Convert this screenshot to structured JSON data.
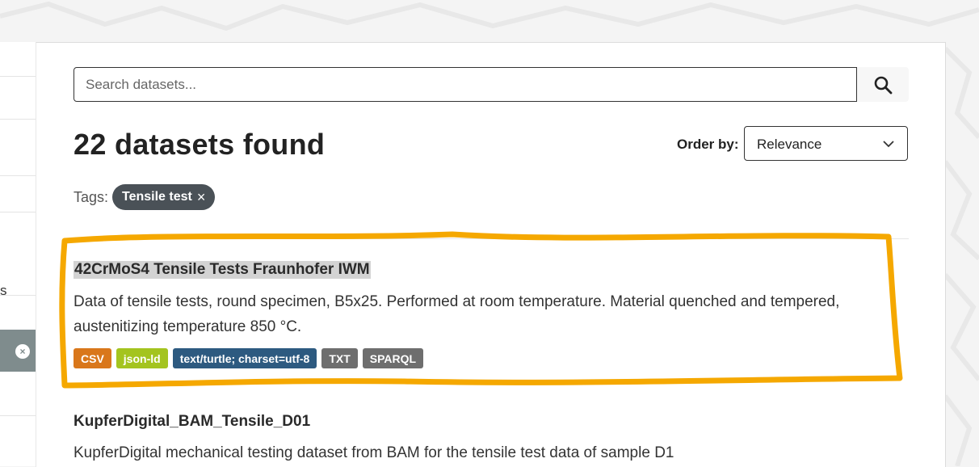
{
  "search": {
    "placeholder": "Search datasets..."
  },
  "results": {
    "heading": "22 datasets found",
    "order_by_label": "Order by:",
    "order_by_value": "Relevance"
  },
  "tags": {
    "label": "Tags:",
    "active": [
      {
        "label": "Tensile test",
        "remove": "×"
      }
    ]
  },
  "sidebar": {
    "text_fragment": "s",
    "remove_icon": "×"
  },
  "datasets": [
    {
      "title": "42CrMoS4 Tensile Tests Fraunhofer IWM",
      "description": "Data of tensile tests, round specimen, B5x25. Performed at room temperature. Material quenched and tempered, austenitizing temperature 850 °C.",
      "formats": [
        {
          "label": "CSV",
          "color": "#d9771b"
        },
        {
          "label": "json-ld",
          "color": "#a4c41f"
        },
        {
          "label": "text/turtle; charset=utf-8",
          "color": "#2d5a80"
        },
        {
          "label": "TXT",
          "color": "#6e6e6e"
        },
        {
          "label": "SPARQL",
          "color": "#6e6e6e"
        }
      ]
    },
    {
      "title": "KupferDigital_BAM_Tensile_D01",
      "description": "KupferDigital mechanical testing dataset from BAM for the tensile test data of sample D1"
    }
  ],
  "colors": {
    "annotation": "#f5a800",
    "tag_pill": "#4a5157",
    "highlight": "#d3d3d3"
  }
}
